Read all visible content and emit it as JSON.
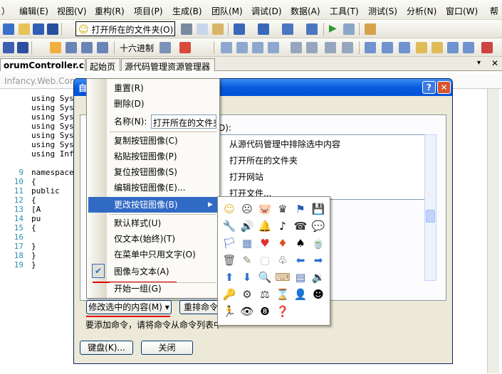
{
  "menubar": {
    "items": [
      "）",
      "编辑(E)",
      "视图(V)",
      "重构(R)",
      "项目(P)",
      "生成(B)",
      "团队(M)",
      "调试(D)",
      "数据(A)",
      "工具(T)",
      "测试(S)",
      "分析(N)",
      "窗口(W)",
      "帮"
    ]
  },
  "toolbar1": {
    "custom_button_label": "打开所在的文件夹(O)"
  },
  "toolbar2": {
    "hex_label": "十六进制"
  },
  "tabs": [
    {
      "label": "orumController.cs"
    },
    {
      "label": "起始页"
    },
    {
      "label": "源代码管理资源管理器"
    }
  ],
  "editor": {
    "path": "Infancy.Web.Contr",
    "lines": [
      {
        "n": "",
        "t": "using Syst"
      },
      {
        "n": "",
        "t": "using Syst"
      },
      {
        "n": "",
        "t": "using Syst"
      },
      {
        "n": "",
        "t": "using Syst"
      },
      {
        "n": "",
        "t": "using Syst"
      },
      {
        "n": "",
        "t": "using Syst"
      },
      {
        "n": "",
        "t": "using Infa"
      },
      {
        "n": "",
        "t": ""
      },
      {
        "n": "9",
        "t": "namespace"
      },
      {
        "n": "10",
        "t": "{"
      },
      {
        "n": "11",
        "t": "    public"
      },
      {
        "n": "12",
        "t": "    {"
      },
      {
        "n": "13",
        "t": "        [A"
      },
      {
        "n": "14",
        "t": "        pu"
      },
      {
        "n": "15",
        "t": "        {"
      },
      {
        "n": "16",
        "t": ""
      },
      {
        "n": "17",
        "t": "        }"
      },
      {
        "n": "18",
        "t": "    }"
      },
      {
        "n": "19",
        "t": "}"
      }
    ]
  },
  "dialog": {
    "title": "自",
    "help": "?",
    "close": "✕",
    "commands_caption": "D):",
    "commands": [
      "从源代码管理中排除选中内容",
      "打开所在的文件夹",
      "打开网站",
      "打开文件..."
    ],
    "modify_button": "修改选中的内容(M) ▾",
    "rearrange_button": "重排命令",
    "hint": "要添加命令，请将命令从命令列表中",
    "keyboard_button": "键盘(K)...",
    "close_button": "关闭"
  },
  "context_menu": {
    "items": [
      "重置(R)",
      "删除(D)",
      "名称(N):",
      "复制按钮图像(C)",
      "粘贴按钮图像(P)",
      "复位按钮图像(S)",
      "编辑按钮图像(E)...",
      "更改按钮图像(B)",
      "默认样式(U)",
      "仅文本(始终)(T)",
      "在菜单中只用文字(O)",
      "图像与文本(A)",
      "开始一组(G)"
    ],
    "name_value": "打开所在的文件夹",
    "submenu_arrow": "▶",
    "check": "✔"
  },
  "icon_picker": {
    "icons": [
      "☺",
      "☹",
      "🐷",
      "♛",
      "⚑",
      "💾",
      "🔧",
      "🔊",
      "🔔",
      "♪",
      "☎",
      "💬",
      "🏳",
      "▦",
      "♥",
      "♦",
      "♠",
      "🍵",
      "🗑",
      "✎",
      "▢",
      "♧",
      "⬅",
      "➡",
      "⬆",
      "⬇",
      "🔍",
      "⌨",
      "▤",
      "🔉",
      "🔑",
      "⚙",
      "⚖",
      "⌛",
      "👤",
      "☻",
      "🏃",
      "👁",
      "❽",
      "❓"
    ]
  },
  "colors": {
    "accent": "#316ac5",
    "title": "#0a5adf",
    "underline": "#e00000"
  }
}
